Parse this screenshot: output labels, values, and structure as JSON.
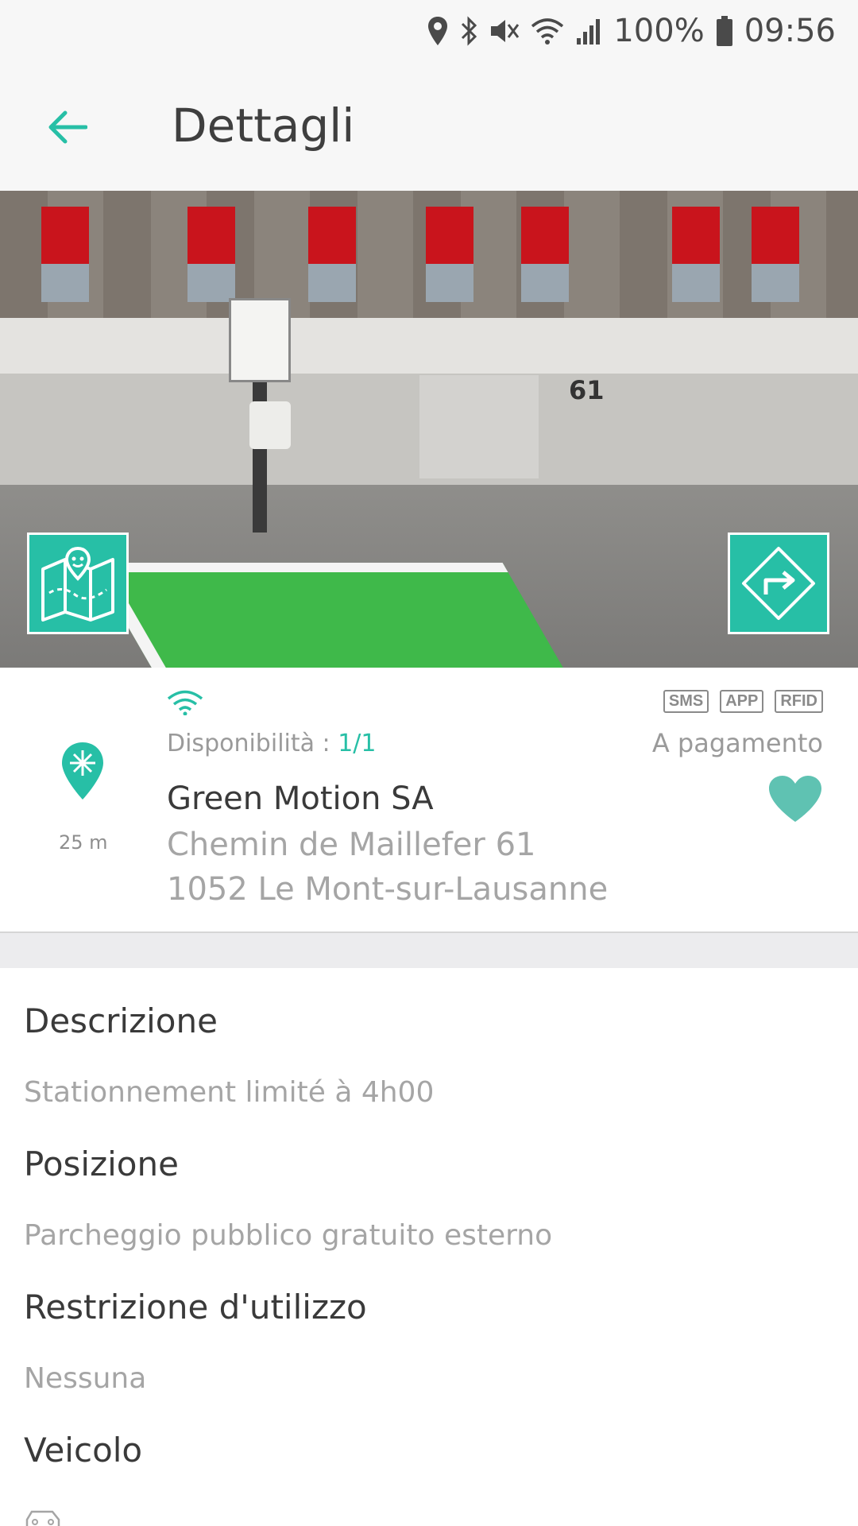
{
  "status_bar": {
    "battery": "100%",
    "time": "09:56",
    "icons": [
      "location-icon",
      "bluetooth-icon",
      "mute-icon",
      "wifi-icon",
      "signal-icon",
      "battery-icon"
    ]
  },
  "app_bar": {
    "title": "Dettagli",
    "back_icon": "arrow-left-icon"
  },
  "hero": {
    "building_number": "61",
    "left_button_icon": "map-icon",
    "right_button_icon": "directions-icon"
  },
  "station": {
    "distance": "25 m",
    "availability_label": "Disponibilità :",
    "availability_value": "1/1",
    "name": "Green Motion SA",
    "address_line1": "Chemin de Maillefer 61",
    "address_line2": "1052 Le Mont-sur-Lausanne",
    "payment_methods": [
      "SMS",
      "APP",
      "RFID"
    ],
    "payment": "A pagamento",
    "favorite_icon": "heart-icon"
  },
  "details": {
    "description_title": "Descrizione",
    "description_value": "Stationnement limité à 4h00",
    "position_title": "Posizione",
    "position_value": "Parcheggio pubblico gratuito esterno",
    "restriction_title": "Restrizione d'utilizzo",
    "restriction_value": "Nessuna",
    "vehicle_title": "Veicolo",
    "vehicle_icon": "car-icon"
  },
  "colors": {
    "accent": "#27bfa6",
    "text_primary": "#3a3a3a",
    "text_secondary": "#a5a5a5"
  }
}
